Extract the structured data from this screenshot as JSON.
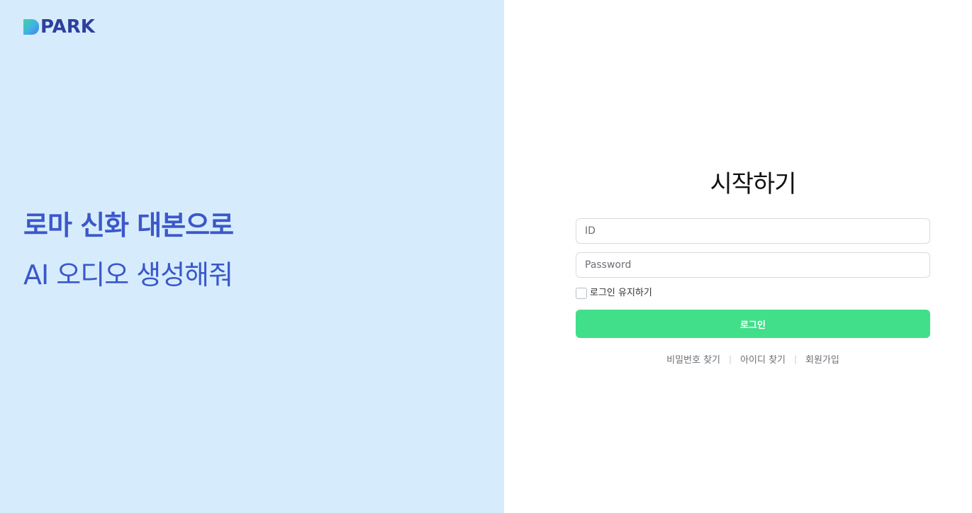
{
  "brand": {
    "logo_text": "PARK",
    "logo_icon": "park-logo-mark"
  },
  "hero": {
    "line1": "로마 신화 대본으로",
    "line2": "AI 오디오 생성해줘"
  },
  "login": {
    "title": "시작하기",
    "id_placeholder": "ID",
    "id_value": "",
    "password_placeholder": "Password",
    "password_value": "",
    "remember_label": "로그인 유지하기",
    "remember_checked": false,
    "submit_label": "로그인"
  },
  "links": {
    "find_password": "비밀번호 찾기",
    "find_id": "아이디 찾기",
    "signup": "회원가입",
    "separator": "|"
  },
  "colors": {
    "left_bg": "#d6ecfd",
    "brand_text": "#2f3f9e",
    "hero_text": "#3b58c9",
    "button_bg": "#41df89"
  }
}
